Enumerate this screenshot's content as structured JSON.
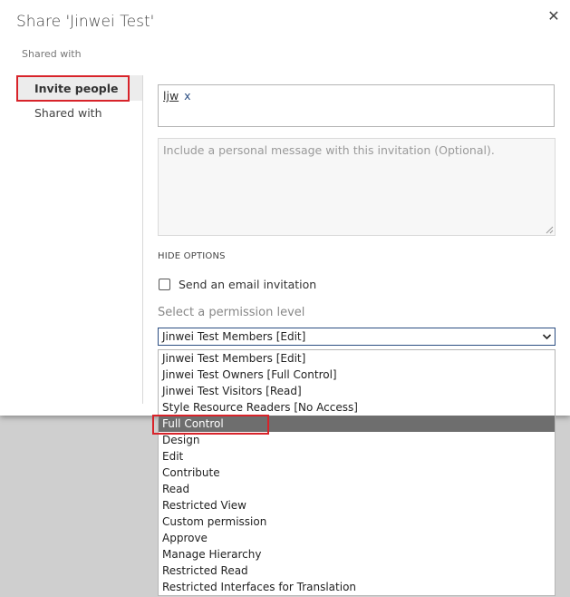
{
  "dialog": {
    "title": "Share 'Jinwei Test'",
    "subtitle": "Shared with",
    "close_glyph": "✕"
  },
  "nav": {
    "items": [
      {
        "label": "Invite people",
        "active": true
      },
      {
        "label": "Shared with",
        "active": false
      }
    ]
  },
  "invite": {
    "people": [
      {
        "name": "ljw",
        "remove": "x"
      }
    ],
    "message_placeholder": "Include a personal message with this invitation (Optional).",
    "hide_options_label": "HIDE OPTIONS",
    "email_invitation_label": "Send an email invitation",
    "email_invitation_checked": false,
    "permission_label": "Select a permission level",
    "permission_selected": "Jinwei Test Members [Edit]",
    "permission_options": [
      "Jinwei Test Members [Edit]",
      "Jinwei Test Owners [Full Control]",
      "Jinwei Test Visitors [Read]",
      "Style Resource Readers [No Access]",
      "Full Control",
      "Design",
      "Edit",
      "Contribute",
      "Read",
      "Restricted View",
      "Custom permission",
      "Approve",
      "Manage Hierarchy",
      "Restricted Read",
      "Restricted Interfaces for Translation"
    ],
    "highlighted_option": "Full Control"
  },
  "colors": {
    "highlight_border": "#d8232a",
    "selected_option_bg": "#6e6e6e",
    "select_border": "#2c4e82"
  },
  "icons": {
    "close": "close-icon",
    "dropdown": "chevron-down-icon",
    "resize": "resize-grip-icon"
  }
}
